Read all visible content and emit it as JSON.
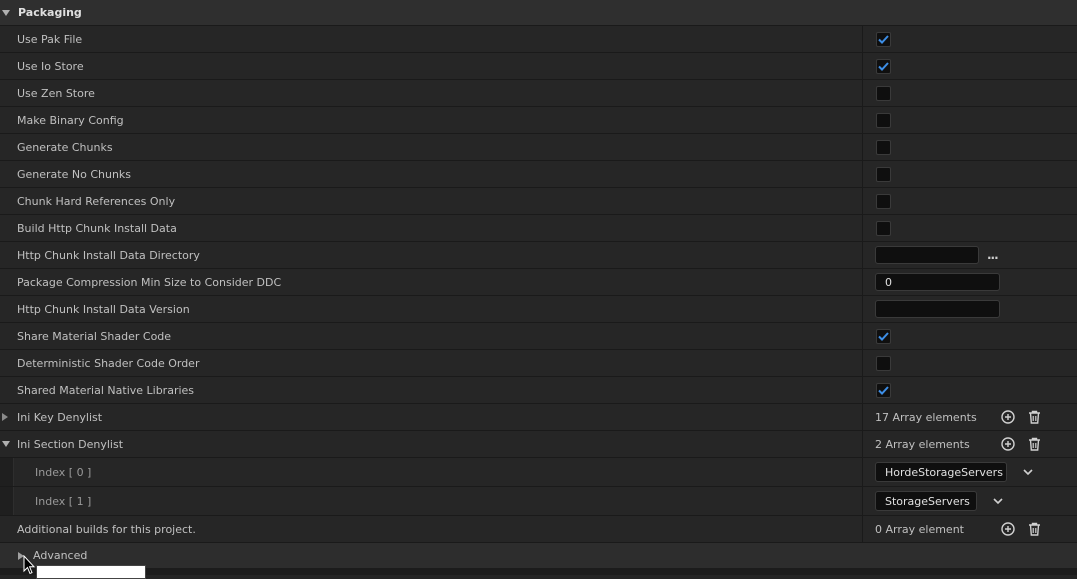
{
  "section": {
    "title": "Packaging"
  },
  "rows": {
    "use_pak_file": {
      "label": "Use Pak File",
      "checked": true
    },
    "use_io_store": {
      "label": "Use Io Store",
      "checked": true
    },
    "use_zen_store": {
      "label": "Use Zen Store",
      "checked": false
    },
    "make_binary_config": {
      "label": "Make Binary Config",
      "checked": false
    },
    "generate_chunks": {
      "label": "Generate Chunks",
      "checked": false
    },
    "generate_no_chunks": {
      "label": "Generate No Chunks",
      "checked": false
    },
    "chunk_hard_refs": {
      "label": "Chunk Hard References Only",
      "checked": false
    },
    "build_http_chunk": {
      "label": "Build Http Chunk Install Data",
      "checked": false
    },
    "http_chunk_dir": {
      "label": "Http Chunk Install Data Directory",
      "value": "",
      "browse": "..."
    },
    "pkg_compression_min": {
      "label": "Package Compression Min Size to Consider DDC",
      "value": "0"
    },
    "http_chunk_version": {
      "label": "Http Chunk Install Data Version",
      "value": ""
    },
    "share_material_shader": {
      "label": "Share Material Shader Code",
      "checked": true
    },
    "deterministic_shader": {
      "label": "Deterministic Shader Code Order",
      "checked": false
    },
    "shared_native_libs": {
      "label": "Shared Material Native Libraries",
      "checked": true
    },
    "ini_key_denylist": {
      "label": "Ini Key Denylist",
      "count": "17 Array elements"
    },
    "ini_section_denylist": {
      "label": "Ini Section Denylist",
      "count": "2 Array elements",
      "items": [
        {
          "index": "Index [ 0 ]",
          "value": "HordeStorageServers"
        },
        {
          "index": "Index [ 1 ]",
          "value": "StorageServers"
        }
      ]
    },
    "additional_builds": {
      "label": "Additional builds for this project.",
      "count": "0 Array element"
    }
  },
  "advanced": {
    "label": "Advanced"
  },
  "colors": {
    "accent": "#3d8ee6",
    "background": "#242424"
  }
}
